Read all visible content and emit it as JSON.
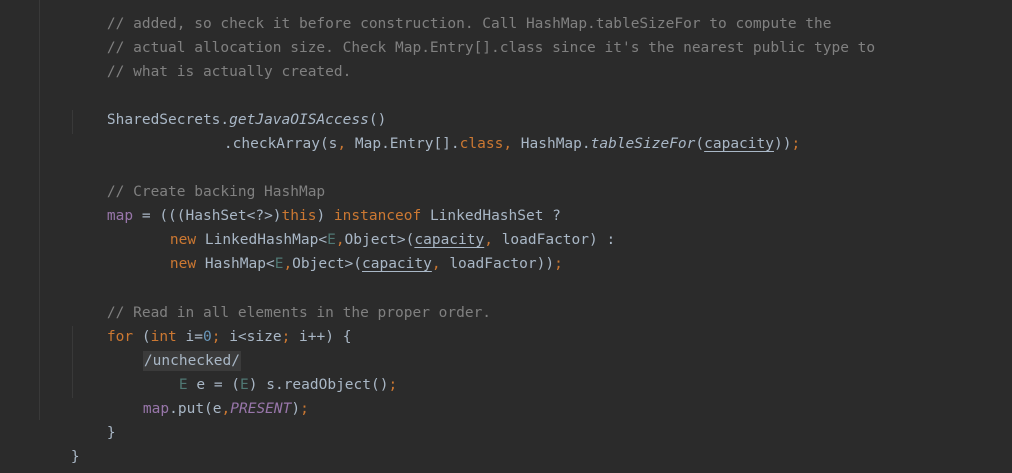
{
  "editor": {
    "comment": {
      "line1": "// added, so check it before construction. Call HashMap.tableSizeFor to compute the",
      "line2": "// actual allocation size. Check Map.Entry[].class since it's the nearest public type to",
      "line3": "// what is actually created."
    },
    "check": {
      "class_name": "SharedSecrets",
      "dot": ".",
      "method": "getJavaOISAccess",
      "parens": "()",
      "cont_dot": ".",
      "cont_method": "checkArray(s",
      "comma1": ",",
      "arg2": " Map.Entry[].",
      "class_kw": "class",
      "comma2": ",",
      "arg3": " HashMap.",
      "static_method": "tableSizeFor",
      "open_paren": "(",
      "param": "capacity",
      "close_parens": "))",
      "semi": ";"
    },
    "backing": {
      "comment": "// Create backing HashMap",
      "map_field": "map",
      "assign": " = (((HashSet<?>)",
      "this_kw": "this",
      "close_paren": ") ",
      "instanceof_kw": "instanceof",
      "rest": " LinkedHashSet ?",
      "new1_kw": "new",
      "type1": " LinkedHashMap<",
      "type_param1": "E",
      "comma1": ",",
      "object1": "Object>(",
      "param1": "capacity",
      "comma2": ",",
      "load1": " loadFactor) :",
      "new2_kw": "new",
      "type2": " HashMap<",
      "type_param2": "E",
      "comma3": ",",
      "object2": "Object>(",
      "param2": "capacity",
      "comma4": ",",
      "load2": " loadFactor))",
      "semi": ";"
    },
    "loop": {
      "comment": "// Read in all elements in the proper order.",
      "for_kw": "for",
      "open": " (",
      "int_kw": "int",
      "init": " i=",
      "zero": "0",
      "semi1": ";",
      "cond": " i<size",
      "semi2": ";",
      "incr": " i++) {",
      "fold_label": "/unchecked/",
      "type_param": "E",
      "decl": " e = (",
      "type_param_cast": "E",
      "read": ") s.readObject()",
      "semi3": ";",
      "map_field": "map",
      "put": ".put(e",
      "comma": ",",
      "present_field": "PRESENT",
      "put_close": ")",
      "semi4": ";",
      "close_brace": "}"
    },
    "method_close_brace": "}"
  }
}
